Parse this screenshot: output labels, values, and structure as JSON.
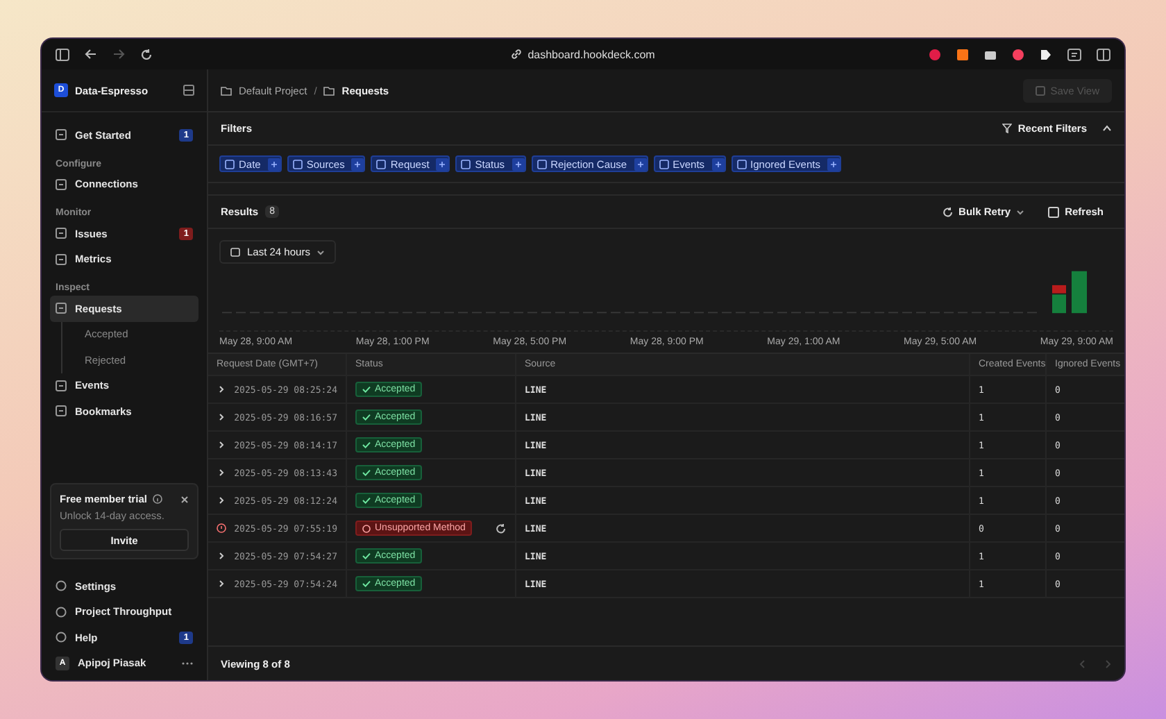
{
  "browser": {
    "url": "dashboard.hookdeck.com"
  },
  "sidebar": {
    "workspace": {
      "initial": "D",
      "name": "Data-Espresso"
    },
    "items": [
      {
        "kind": "item",
        "label": "Get Started",
        "badge": {
          "text": "1",
          "color": "#1e3a8a"
        },
        "selected": false
      },
      {
        "kind": "section",
        "label": "Configure"
      },
      {
        "kind": "item",
        "label": "Connections",
        "selected": false
      },
      {
        "kind": "section",
        "label": "Monitor"
      },
      {
        "kind": "item",
        "label": "Issues",
        "badge": {
          "text": "1",
          "color": "#7f1d1d"
        },
        "selected": false
      },
      {
        "kind": "item",
        "label": "Metrics",
        "selected": false
      },
      {
        "kind": "section",
        "label": "Inspect"
      },
      {
        "kind": "item",
        "label": "Requests",
        "selected": true
      },
      {
        "kind": "subitem",
        "label": "Accepted",
        "selected": false
      },
      {
        "kind": "subitem",
        "label": "Rejected",
        "selected": false
      },
      {
        "kind": "item",
        "label": "Events",
        "selected": false
      },
      {
        "kind": "item",
        "label": "Bookmarks",
        "selected": false
      }
    ],
    "trial": {
      "title": "Free member trial",
      "text": "Unlock 14-day access.",
      "button": "Invite"
    },
    "footer_items": [
      {
        "label": "Settings"
      },
      {
        "label": "Project Throughput"
      },
      {
        "label": "Help",
        "badge": {
          "text": "1",
          "color": "#1e3a8a"
        }
      }
    ],
    "user": {
      "initial": "A",
      "name": "Apipoj Piasak"
    }
  },
  "breadcrumb": [
    {
      "label": "Default Project",
      "current": false
    },
    {
      "label": "Requests",
      "current": true
    }
  ],
  "breadcrumb_separator": "/",
  "save_button": {
    "label": "Save View",
    "disabled": true
  },
  "filters": {
    "title": "Filters",
    "recent": "Recent Filters",
    "expanded": true,
    "chips": [
      "Date",
      "Sources",
      "Request",
      "Status",
      "Rejection Cause",
      "Events",
      "Ignored Events"
    ]
  },
  "results": {
    "title": "Results",
    "count": "8",
    "bulk_retry": "Bulk Retry",
    "refresh": "Refresh",
    "range": "Last 24 hours",
    "axis_labels": [
      "May 28, 9:00 AM",
      "May 28, 1:00 PM",
      "May 28, 5:00 PM",
      "May 28, 9:00 PM",
      "May 29, 1:00 AM",
      "May 29, 5:00 AM",
      "May 29, 9:00 AM"
    ]
  },
  "table": {
    "columns": [
      "Request Date (GMT+7)",
      "Status",
      "Source",
      "Created Events",
      "Ignored Events"
    ],
    "rows": [
      {
        "date": "2025-05-29 08:25:24",
        "status": "Accepted",
        "kind": "accepted",
        "source": "LINE",
        "created": "1",
        "ignored": "0"
      },
      {
        "date": "2025-05-29 08:16:57",
        "status": "Accepted",
        "kind": "accepted",
        "source": "LINE",
        "created": "1",
        "ignored": "0"
      },
      {
        "date": "2025-05-29 08:14:17",
        "status": "Accepted",
        "kind": "accepted",
        "source": "LINE",
        "created": "1",
        "ignored": "0"
      },
      {
        "date": "2025-05-29 08:13:43",
        "status": "Accepted",
        "kind": "accepted",
        "source": "LINE",
        "created": "1",
        "ignored": "0"
      },
      {
        "date": "2025-05-29 08:12:24",
        "status": "Accepted",
        "kind": "accepted",
        "source": "LINE",
        "created": "1",
        "ignored": "0"
      },
      {
        "date": "2025-05-29 07:55:19",
        "status": "Unsupported Method",
        "kind": "rejected",
        "source": "LINE",
        "created": "0",
        "ignored": "0"
      },
      {
        "date": "2025-05-29 07:54:27",
        "status": "Accepted",
        "kind": "accepted",
        "source": "LINE",
        "created": "1",
        "ignored": "0"
      },
      {
        "date": "2025-05-29 07:54:24",
        "status": "Accepted",
        "kind": "accepted",
        "source": "LINE",
        "created": "1",
        "ignored": "0"
      }
    ],
    "footer": "Viewing 8 of 8"
  }
}
